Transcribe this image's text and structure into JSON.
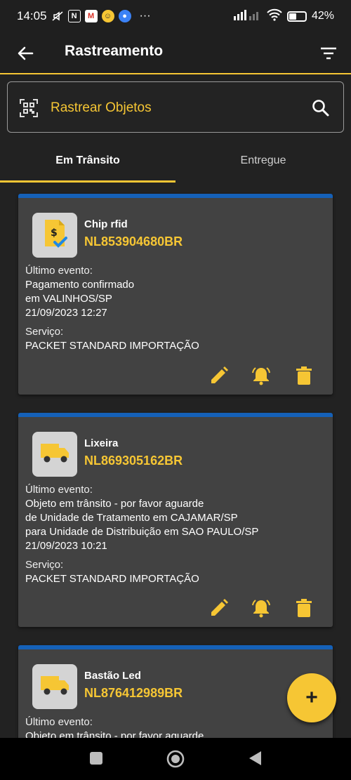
{
  "status_bar": {
    "time": "14:05",
    "battery": "42%",
    "more": "···",
    "icons": [
      "mute-icon",
      "nfc-icon",
      "gmail-icon",
      "emoji-app-icon",
      "account-icon",
      "signal-icon",
      "wifi-icon",
      "battery-icon"
    ]
  },
  "app_bar": {
    "title": "Rastreamento",
    "icons": [
      "back-arrow-icon",
      "filter-icon"
    ]
  },
  "search": {
    "placeholder": "Rastrear Objetos",
    "icons": [
      "qr-scan-icon",
      "search-icon"
    ]
  },
  "tabs": [
    {
      "label": "Em Trânsito",
      "active": true
    },
    {
      "label": "Entregue",
      "active": false
    }
  ],
  "labels": {
    "last_event": "Último evento:",
    "service": "Serviço:"
  },
  "packages": [
    {
      "name": "Chip rfid",
      "code": "NL853904680BR",
      "icon": "payment-confirmed-icon",
      "event_lines": [
        "Pagamento confirmado",
        "em VALINHOS/SP",
        "21/09/2023 12:27"
      ],
      "service": "PACKET STANDARD IMPORTAÇÃO"
    },
    {
      "name": "Lixeira",
      "code": "NL869305162BR",
      "icon": "truck-icon",
      "event_lines": [
        "Objeto em trânsito - por favor aguarde",
        "de Unidade de Tratamento em CAJAMAR/SP",
        "para Unidade de Distribuição em SAO PAULO/SP",
        "21/09/2023 10:21"
      ],
      "service": "PACKET STANDARD IMPORTAÇÃO"
    },
    {
      "name": "Bastão Led",
      "code": "NL876412989BR",
      "icon": "truck-icon",
      "event_lines": [
        "Objeto em trânsito - por favor aguarde"
      ]
    }
  ],
  "card_actions": [
    "edit-icon",
    "notification-bell-icon",
    "delete-icon"
  ],
  "fab": {
    "label": "+"
  },
  "colors": {
    "accent": "#f6c634",
    "card_top_border": "#1561b8",
    "background": "#222222",
    "card": "#424242"
  }
}
